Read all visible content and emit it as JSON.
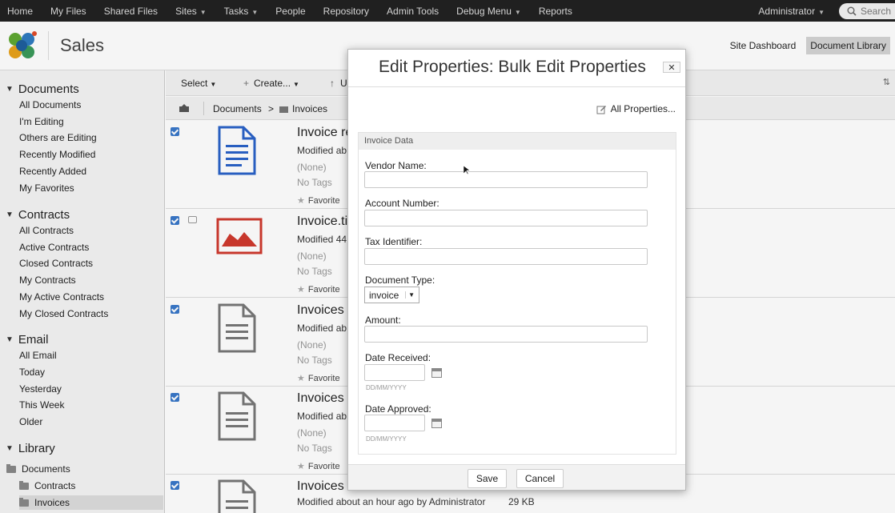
{
  "topnav": {
    "items": [
      {
        "label": "Home",
        "caret": false
      },
      {
        "label": "My Files",
        "caret": false
      },
      {
        "label": "Shared Files",
        "caret": false
      },
      {
        "label": "Sites",
        "caret": true
      },
      {
        "label": "Tasks",
        "caret": true
      },
      {
        "label": "People",
        "caret": false
      },
      {
        "label": "Repository",
        "caret": false
      },
      {
        "label": "Admin Tools",
        "caret": false
      },
      {
        "label": "Debug Menu",
        "caret": true
      },
      {
        "label": "Reports",
        "caret": false
      }
    ],
    "user": "Administrator",
    "search_placeholder": "Search"
  },
  "site": {
    "title": "Sales",
    "links": [
      "Site Dashboard",
      "Document Library"
    ],
    "active_link": "Document Library"
  },
  "sidebar": {
    "documents": {
      "heading": "Documents",
      "items": [
        "All Documents",
        "I'm Editing",
        "Others are Editing",
        "Recently Modified",
        "Recently Added",
        "My Favorites"
      ]
    },
    "contracts": {
      "heading": "Contracts",
      "items": [
        "All Contracts",
        "Active Contracts",
        "Closed Contracts",
        "My Contracts",
        "My Active Contracts",
        "My Closed Contracts"
      ]
    },
    "email": {
      "heading": "Email",
      "items": [
        "All Email",
        "Today",
        "Yesterday",
        "This Week",
        "Older"
      ]
    },
    "library": {
      "heading": "Library",
      "folders": [
        "Documents",
        "Contracts",
        "Invoices"
      ]
    }
  },
  "toolbar": {
    "select_label": "Select",
    "create_label": "Create...",
    "upload_label": "U"
  },
  "path": {
    "root": "Documents",
    "sep": ">",
    "current": "Invoices"
  },
  "documents": [
    {
      "name": "Invoice re",
      "meta": "Modified ab",
      "desc": "(None)",
      "tags": "No Tags",
      "fav": "Favorite",
      "icon": "document-blue-icon",
      "checked": true,
      "extra": false
    },
    {
      "name": "Invoice.ti",
      "meta": "Modified 44",
      "desc": "(None)",
      "tags": "No Tags",
      "fav": "Favorite",
      "icon": "image-red-icon",
      "checked": true,
      "extra": true
    },
    {
      "name": "Invoices",
      "meta": "Modified ab",
      "desc": "(None)",
      "tags": "No Tags",
      "fav": "Favorite",
      "icon": "document-gray-icon",
      "checked": true,
      "extra": false
    },
    {
      "name": "Invoices",
      "meta": "Modified ab",
      "desc": "(None)",
      "tags": "No Tags",
      "fav": "Favorite",
      "icon": "document-gray-icon",
      "checked": true,
      "extra": false
    },
    {
      "name": "Invoices",
      "meta": "Modified about an hour ago by Administrator",
      "size": "29 KB",
      "icon": "document-gray-icon",
      "checked": true,
      "extra": false
    }
  ],
  "dialog": {
    "title": "Edit Properties: Bulk Edit Properties",
    "close": "✕",
    "all_properties": "All Properties...",
    "section": "Invoice Data",
    "fields": {
      "vendor_name": {
        "label": "Vendor Name:",
        "value": ""
      },
      "account_number": {
        "label": "Account Number:",
        "value": ""
      },
      "tax_identifier": {
        "label": "Tax Identifier:",
        "value": ""
      },
      "document_type": {
        "label": "Document Type:",
        "value": "invoice"
      },
      "amount": {
        "label": "Amount:",
        "value": ""
      },
      "date_received": {
        "label": "Date Received:",
        "value": "",
        "hint": "DD/MM/YYYY"
      },
      "date_approved": {
        "label": "Date Approved:",
        "value": "",
        "hint": "DD/MM/YYYY"
      }
    },
    "save_label": "Save",
    "cancel_label": "Cancel"
  },
  "colors": {
    "accent": "#3a78c9",
    "nav_bg": "#222222",
    "sidebar_bg": "#f4f4f4"
  }
}
